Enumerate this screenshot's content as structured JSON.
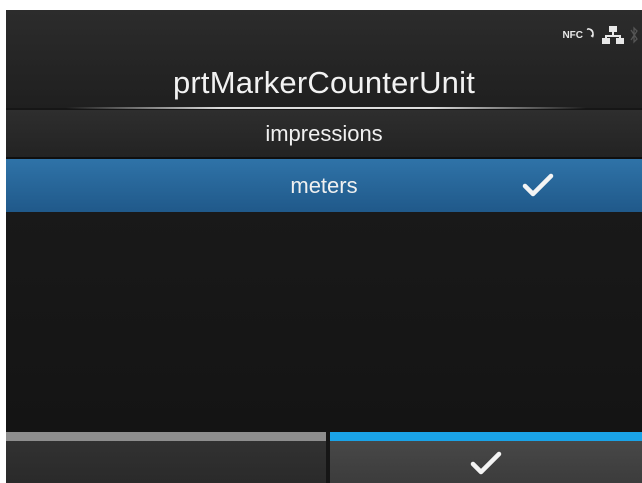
{
  "header": {
    "title": "prtMarkerCounterUnit",
    "status_icons": {
      "nfc_label": "NFC",
      "nfc": "nfc-icon",
      "network": "lan-icon",
      "bluetooth": "bluetooth-icon"
    }
  },
  "options": [
    {
      "label": "impressions",
      "selected": false
    },
    {
      "label": "meters",
      "selected": true
    }
  ],
  "footer": {
    "left_button": "back",
    "right_button": "confirm-check",
    "accent_color": "#1aa3e8"
  },
  "colors": {
    "selected_row": "#2a6a9e",
    "background": "#161616"
  }
}
